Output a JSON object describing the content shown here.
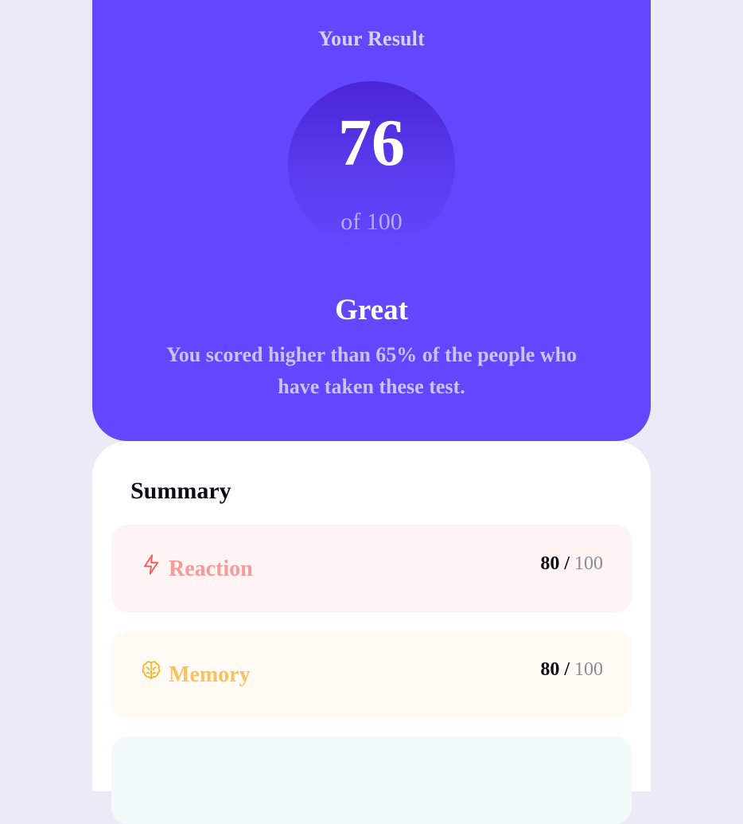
{
  "result": {
    "heading": "Your Result",
    "score": "76",
    "score_total": "of 100",
    "rating": "Great",
    "description": "You scored higher than 65% of the people who have taken these test."
  },
  "summary": {
    "title": "Summary",
    "items": [
      {
        "label": "Reaction",
        "score": "80",
        "separator": "/",
        "max": "100",
        "icon": "lightning-icon",
        "color": "#f55b5b"
      },
      {
        "label": "Memory",
        "score": "80",
        "separator": "/",
        "max": "100",
        "icon": "brain-icon",
        "color": "#f7b526"
      }
    ]
  },
  "colors": {
    "accent": "#6347fe",
    "background": "#ebeaf6"
  }
}
